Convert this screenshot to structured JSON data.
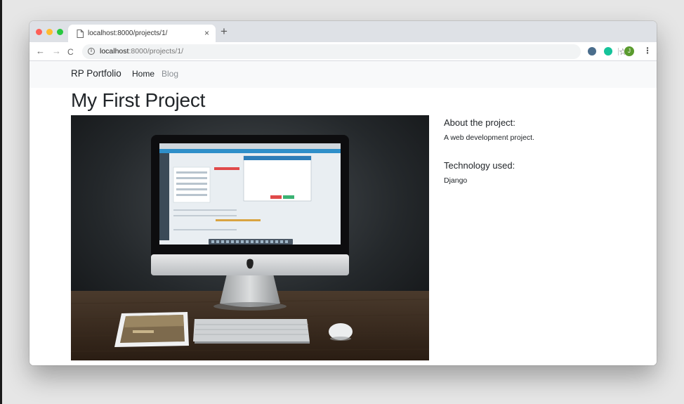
{
  "browser": {
    "tab_title": "localhost:8000/projects/1/",
    "tab_close": "×",
    "new_tab": "+",
    "url_host": "localhost",
    "url_path": ":8000/projects/1/",
    "nav_back": "←",
    "nav_forward": "→",
    "nav_reload": "C",
    "info": "i",
    "star": "☆",
    "avatar_initial": "J",
    "menu": "⋮",
    "traffic_colors": [
      "#fe5f57",
      "#febc2e",
      "#28c840"
    ]
  },
  "navbar": {
    "brand": "RP Portfolio",
    "links": [
      "Home",
      "Blog"
    ]
  },
  "project": {
    "title": "My First Project",
    "about_heading": "About the project:",
    "about_text": "A web development project.",
    "tech_heading": "Technology used:",
    "tech_text": "Django"
  },
  "colors": {
    "navbar_bg": "#f8f9fa",
    "text": "#212529",
    "muted_link": "#8a8f94"
  }
}
